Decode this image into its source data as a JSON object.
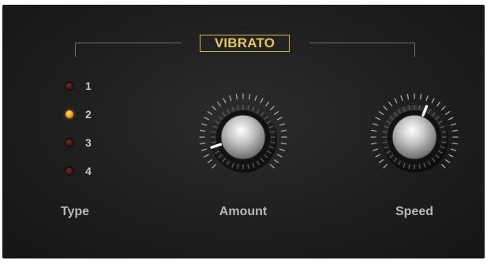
{
  "section": {
    "title": "VIBRATO"
  },
  "type_selector": {
    "label": "Type",
    "selected": "2",
    "options": [
      {
        "label": "1",
        "active": false
      },
      {
        "label": "2",
        "active": true
      },
      {
        "label": "3",
        "active": false
      },
      {
        "label": "4",
        "active": false
      }
    ]
  },
  "knobs": {
    "amount": {
      "label": "Amount",
      "value": 0.1
    },
    "speed": {
      "label": "Speed",
      "value": 0.58
    }
  },
  "colors": {
    "panel": "#1e1e1e",
    "title_gold": "#e6c659",
    "led_on": "#f2a425",
    "led_off": "#3c1512",
    "label_gray": "#b9b9b9"
  }
}
